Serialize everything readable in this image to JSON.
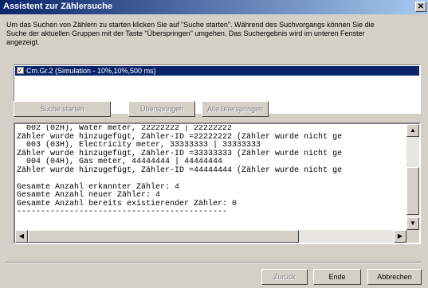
{
  "window": {
    "title": "Assistent zur Zählersuche",
    "close_glyph": "✕"
  },
  "intro_text": "Um das Suchen von Zählern zu starten klicken Sie auf \"Suche starten\". Während des Suchvorgangs können Sie die\nSuche der aktuellen Gruppen mit der Taste \"Überspringen\" umgehen. Das Suchergebnis wird im unteren Fenster\nangezeigt.",
  "groups": [
    {
      "label": "Cm.Gr.2 (Simulation - 10%,10%,500 ms)",
      "checked": true,
      "check_glyph": "✓"
    }
  ],
  "buttons": {
    "start_search": "Suche starten",
    "skip": "Überspringen",
    "skip_all": "Alle überspringen",
    "back": "Zurück",
    "finish": "Ende",
    "cancel": "Abbrechen"
  },
  "log": [
    "  002 (02H), Water meter, 22222222 | 22222222",
    "Zähler wurde hinzugefügt, Zähler-ID =22222222 (Zähler wurde nicht ge",
    "  003 (03H), Electricity meter, 33333333 | 33333333",
    "Zähler wurde hinzugefügt, Zähler-ID =33333333 (Zähler wurde nicht ge",
    "  004 (04H), Gas meter, 44444444 | 44444444",
    "Zähler wurde hinzugefügt, Zähler-ID =44444444 (Zähler wurde nicht ge",
    "",
    "Gesamte Anzahl erkannter Zähler: 4",
    "Gesamte Anzahl neuer Zähler: 4",
    "Gesamte Anzahl bereits existierender Zähler: 0",
    "--------------------------------------------"
  ],
  "scroll_glyphs": {
    "up": "▲",
    "down": "▼",
    "left": "◀",
    "right": "▶"
  },
  "colors": {
    "title_start": "#0a246a",
    "title_end": "#a6caf0",
    "face": "#d4d0c8",
    "selection": "#0a246a"
  }
}
